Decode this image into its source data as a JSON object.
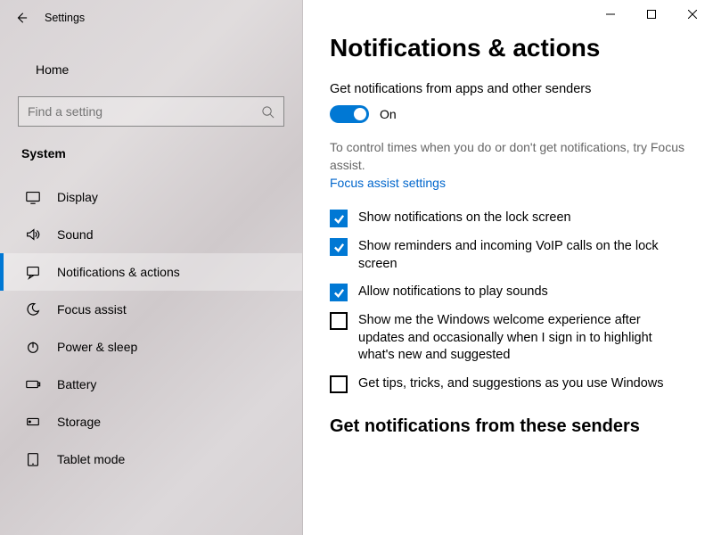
{
  "titlebar": {
    "title": "Settings"
  },
  "sidebar": {
    "home": "Home",
    "search_placeholder": "Find a setting",
    "category": "System",
    "items": [
      {
        "label": "Display"
      },
      {
        "label": "Sound"
      },
      {
        "label": "Notifications & actions"
      },
      {
        "label": "Focus assist"
      },
      {
        "label": "Power & sleep"
      },
      {
        "label": "Battery"
      },
      {
        "label": "Storage"
      },
      {
        "label": "Tablet mode"
      }
    ]
  },
  "page": {
    "title": "Notifications & actions",
    "toggle_label": "Get notifications from apps and other senders",
    "toggle_state": "On",
    "helper_text": "To control times when you do or don't get notifications, try Focus assist.",
    "link": "Focus assist settings",
    "checks": [
      {
        "checked": true,
        "label": "Show notifications on the lock screen"
      },
      {
        "checked": true,
        "label": "Show reminders and incoming VoIP calls on the lock screen"
      },
      {
        "checked": true,
        "label": "Allow notifications to play sounds"
      },
      {
        "checked": false,
        "label": "Show me the Windows welcome experience after updates and occasionally when I sign in to highlight what's new and suggested"
      },
      {
        "checked": false,
        "label": "Get tips, tricks, and suggestions as you use Windows"
      }
    ],
    "section2": "Get notifications from these senders"
  }
}
